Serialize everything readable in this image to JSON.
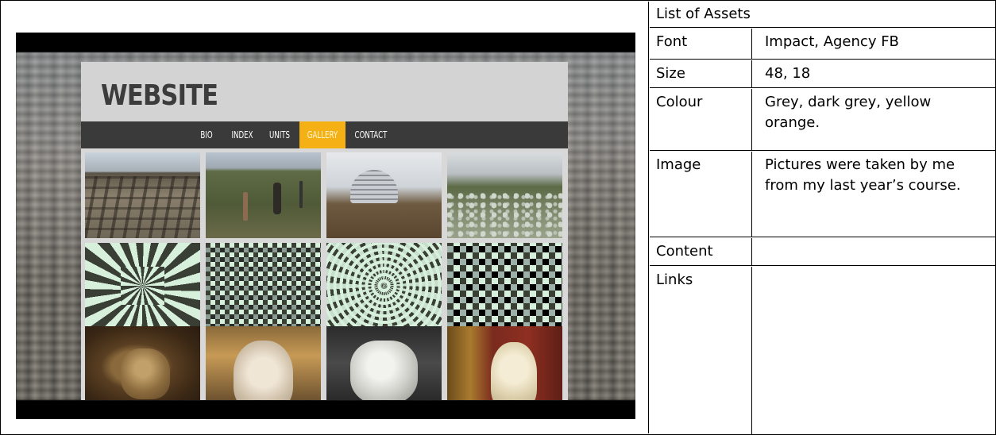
{
  "mockup": {
    "logo": "WEBSITE",
    "nav": [
      "BIO",
      "INDEX",
      "UNITS",
      "GALLERY",
      "CONTACT"
    ],
    "active_nav": "GALLERY",
    "accent_color": "#f5b016",
    "nav_bg_color": "#3a3a3a",
    "header_bg_color": "#d3d3d3"
  },
  "assets_table": {
    "title": "List of Assets",
    "rows": [
      {
        "label": "Font",
        "value": "Impact, Agency FB"
      },
      {
        "label": "Size",
        "value": "48, 18"
      },
      {
        "label": "Colour",
        "value": "Grey, dark grey, yellow orange."
      },
      {
        "label": "Image",
        "value": "Pictures were taken by me from my last year’s course."
      },
      {
        "label": "Content",
        "value": ""
      },
      {
        "label": "Links",
        "value": ""
      }
    ]
  }
}
